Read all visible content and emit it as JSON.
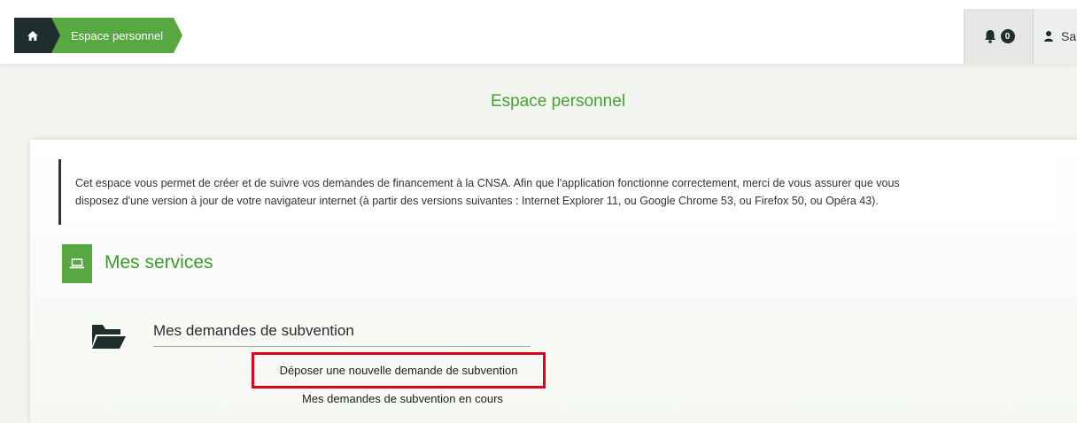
{
  "breadcrumb": {
    "home_icon": "home-icon",
    "current": "Espace personnel"
  },
  "header": {
    "notifications_count": "0",
    "user_name": "Sa"
  },
  "page": {
    "title": "Espace personnel"
  },
  "notice": {
    "line1": "Cet espace vous permet de créer et de suivre vos demandes de financement à la CNSA. Afin que l'application fonctionne correctement, merci de vous assurer que vous",
    "line2": "disposez d'une version à jour de votre navigateur internet (à partir des versions suivantes : Internet Explorer 11, ou Google Chrome 53, ou Firefox 50, ou Opéra 43)."
  },
  "services": {
    "title": "Mes services",
    "section_title": "Mes demandes de subvention",
    "links": [
      "Déposer une nouvelle demande de subvention",
      "Mes demandes de subvention en cours"
    ]
  },
  "colors": {
    "accent": "#57a843",
    "dark": "#1f2d2c",
    "highlight": "#e3001b"
  }
}
